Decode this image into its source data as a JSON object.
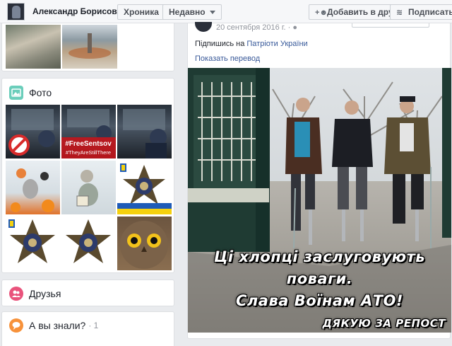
{
  "topbar": {
    "name": "Александр Борисович",
    "timeline": "Хроника",
    "recent": "Недавно",
    "add_friend": "Добавить в друзья",
    "follow": "Подписаться"
  },
  "photos": {
    "title": "Фото",
    "tiles": [
      {
        "label": ""
      },
      {
        "label": "#FreeSentsov\n#TheyAreStillThere"
      },
      {
        "label": ""
      },
      {
        "label": ""
      },
      {
        "label": ""
      },
      {
        "label": ""
      },
      {
        "label": ""
      },
      {
        "label": ""
      },
      {
        "label": ""
      }
    ]
  },
  "friends": {
    "title": "Друзья"
  },
  "did_you_know": {
    "title": "А вы знали?",
    "count": "· 1"
  },
  "post": {
    "date": "20 сентября 2016 г. ·",
    "text_prefix": "Підпишись на ",
    "text_link": "Патріоти України",
    "show_translation": "Показать перевод",
    "caption_line1": "Ці хлопці заслуговують",
    "caption_line2": "поваги.",
    "caption_line3": "Слава Воїнам АТО!",
    "caption_footer": "ДЯКУЮ ЗА РЕПОСТ"
  },
  "colors": {
    "photos_icon": "#6bcebb",
    "friends_icon": "#e9537c",
    "know_icon": "#f7923b",
    "link": "#365899"
  }
}
